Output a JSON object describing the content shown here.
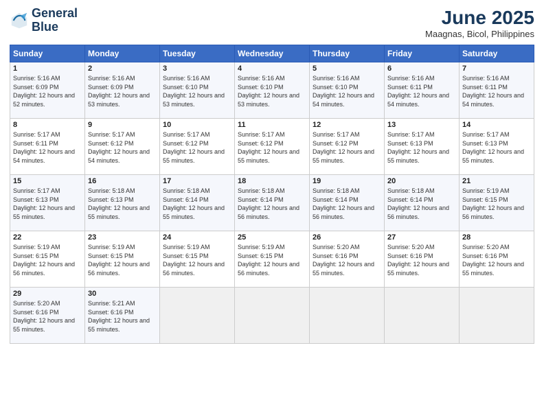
{
  "logo": {
    "line1": "General",
    "line2": "Blue"
  },
  "title": "June 2025",
  "location": "Maagnas, Bicol, Philippines",
  "weekdays": [
    "Sunday",
    "Monday",
    "Tuesday",
    "Wednesday",
    "Thursday",
    "Friday",
    "Saturday"
  ],
  "weeks": [
    [
      {
        "day": "1",
        "sunrise": "5:16 AM",
        "sunset": "6:09 PM",
        "daylight": "12 hours and 52 minutes."
      },
      {
        "day": "2",
        "sunrise": "5:16 AM",
        "sunset": "6:09 PM",
        "daylight": "12 hours and 53 minutes."
      },
      {
        "day": "3",
        "sunrise": "5:16 AM",
        "sunset": "6:10 PM",
        "daylight": "12 hours and 53 minutes."
      },
      {
        "day": "4",
        "sunrise": "5:16 AM",
        "sunset": "6:10 PM",
        "daylight": "12 hours and 53 minutes."
      },
      {
        "day": "5",
        "sunrise": "5:16 AM",
        "sunset": "6:10 PM",
        "daylight": "12 hours and 54 minutes."
      },
      {
        "day": "6",
        "sunrise": "5:16 AM",
        "sunset": "6:11 PM",
        "daylight": "12 hours and 54 minutes."
      },
      {
        "day": "7",
        "sunrise": "5:16 AM",
        "sunset": "6:11 PM",
        "daylight": "12 hours and 54 minutes."
      }
    ],
    [
      {
        "day": "8",
        "sunrise": "5:17 AM",
        "sunset": "6:11 PM",
        "daylight": "12 hours and 54 minutes."
      },
      {
        "day": "9",
        "sunrise": "5:17 AM",
        "sunset": "6:12 PM",
        "daylight": "12 hours and 54 minutes."
      },
      {
        "day": "10",
        "sunrise": "5:17 AM",
        "sunset": "6:12 PM",
        "daylight": "12 hours and 55 minutes."
      },
      {
        "day": "11",
        "sunrise": "5:17 AM",
        "sunset": "6:12 PM",
        "daylight": "12 hours and 55 minutes."
      },
      {
        "day": "12",
        "sunrise": "5:17 AM",
        "sunset": "6:12 PM",
        "daylight": "12 hours and 55 minutes."
      },
      {
        "day": "13",
        "sunrise": "5:17 AM",
        "sunset": "6:13 PM",
        "daylight": "12 hours and 55 minutes."
      },
      {
        "day": "14",
        "sunrise": "5:17 AM",
        "sunset": "6:13 PM",
        "daylight": "12 hours and 55 minutes."
      }
    ],
    [
      {
        "day": "15",
        "sunrise": "5:17 AM",
        "sunset": "6:13 PM",
        "daylight": "12 hours and 55 minutes."
      },
      {
        "day": "16",
        "sunrise": "5:18 AM",
        "sunset": "6:13 PM",
        "daylight": "12 hours and 55 minutes."
      },
      {
        "day": "17",
        "sunrise": "5:18 AM",
        "sunset": "6:14 PM",
        "daylight": "12 hours and 55 minutes."
      },
      {
        "day": "18",
        "sunrise": "5:18 AM",
        "sunset": "6:14 PM",
        "daylight": "12 hours and 56 minutes."
      },
      {
        "day": "19",
        "sunrise": "5:18 AM",
        "sunset": "6:14 PM",
        "daylight": "12 hours and 56 minutes."
      },
      {
        "day": "20",
        "sunrise": "5:18 AM",
        "sunset": "6:14 PM",
        "daylight": "12 hours and 56 minutes."
      },
      {
        "day": "21",
        "sunrise": "5:19 AM",
        "sunset": "6:15 PM",
        "daylight": "12 hours and 56 minutes."
      }
    ],
    [
      {
        "day": "22",
        "sunrise": "5:19 AM",
        "sunset": "6:15 PM",
        "daylight": "12 hours and 56 minutes."
      },
      {
        "day": "23",
        "sunrise": "5:19 AM",
        "sunset": "6:15 PM",
        "daylight": "12 hours and 56 minutes."
      },
      {
        "day": "24",
        "sunrise": "5:19 AM",
        "sunset": "6:15 PM",
        "daylight": "12 hours and 56 minutes."
      },
      {
        "day": "25",
        "sunrise": "5:19 AM",
        "sunset": "6:15 PM",
        "daylight": "12 hours and 56 minutes."
      },
      {
        "day": "26",
        "sunrise": "5:20 AM",
        "sunset": "6:16 PM",
        "daylight": "12 hours and 55 minutes."
      },
      {
        "day": "27",
        "sunrise": "5:20 AM",
        "sunset": "6:16 PM",
        "daylight": "12 hours and 55 minutes."
      },
      {
        "day": "28",
        "sunrise": "5:20 AM",
        "sunset": "6:16 PM",
        "daylight": "12 hours and 55 minutes."
      }
    ],
    [
      {
        "day": "29",
        "sunrise": "5:20 AM",
        "sunset": "6:16 PM",
        "daylight": "12 hours and 55 minutes."
      },
      {
        "day": "30",
        "sunrise": "5:21 AM",
        "sunset": "6:16 PM",
        "daylight": "12 hours and 55 minutes."
      },
      null,
      null,
      null,
      null,
      null
    ]
  ]
}
